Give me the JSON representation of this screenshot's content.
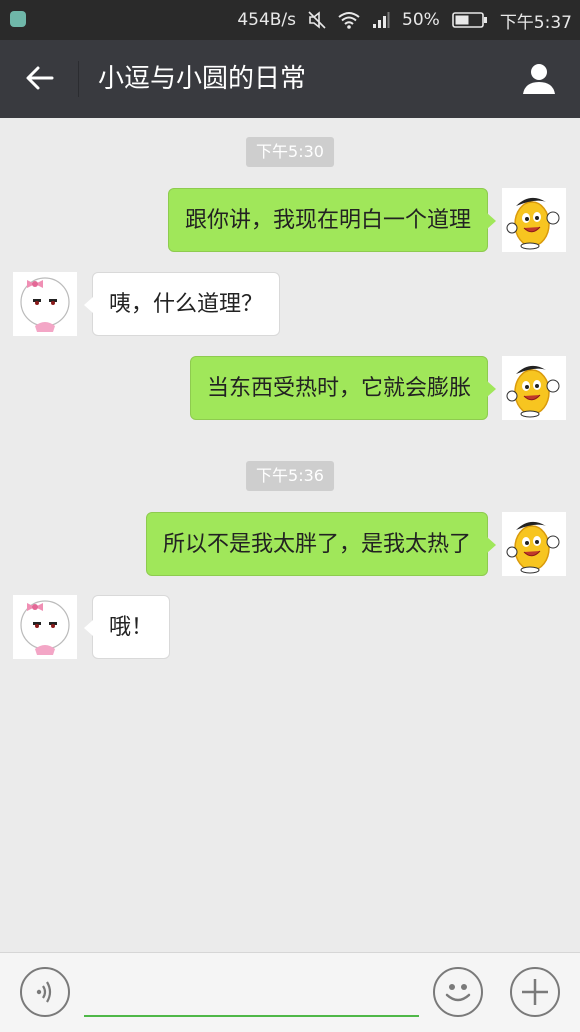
{
  "status_bar": {
    "network_speed": "454B/s",
    "battery_percent": "50%",
    "time": "下午5:37",
    "icons": [
      "app-icon",
      "mute-icon",
      "wifi-icon",
      "signal-icon",
      "battery-icon"
    ]
  },
  "header": {
    "back_icon": "back-arrow-icon",
    "title": "小逗与小圆的日常",
    "profile_icon": "person-icon"
  },
  "messages": {
    "time1": "下午5:30",
    "m1": "跟你讲，我现在明白一个道理",
    "m2": "咦，什么道理？",
    "m3": "当东西受热时，它就会膨胀",
    "time2": "下午5:36",
    "m4": "所以不是我太胖了，是我太热了",
    "m5": "哦！"
  },
  "input_bar": {
    "voice_icon": "voice-icon",
    "emoji_icon": "emoji-icon",
    "more_icon": "plus-icon",
    "text_value": ""
  },
  "colors": {
    "outgoing_bubble": "#a0e75a",
    "incoming_bubble": "#ffffff",
    "header_bg": "#393a3f",
    "chat_bg": "#ebebeb",
    "input_accent": "#4fb848"
  }
}
